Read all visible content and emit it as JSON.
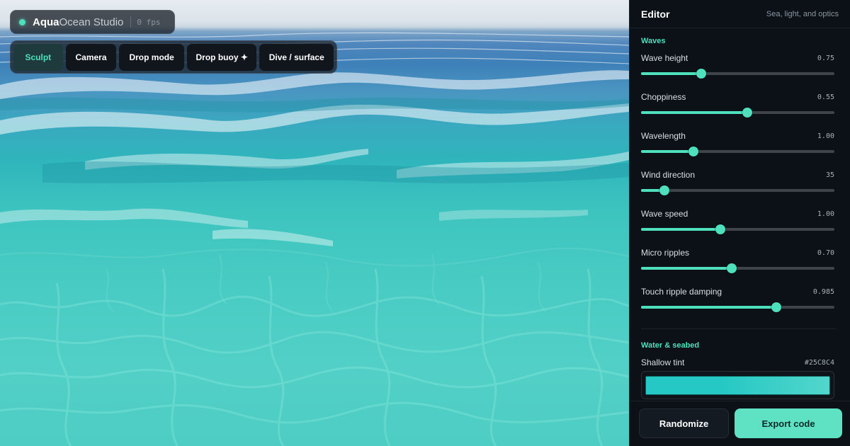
{
  "header": {
    "brand_strong": "Aqua",
    "brand_rest": "Ocean Studio",
    "fps": "0 fps"
  },
  "toolbar": {
    "items": [
      {
        "label": "Sculpt",
        "active": true
      },
      {
        "label": "Camera",
        "active": false
      },
      {
        "label": "Drop mode",
        "active": false
      },
      {
        "label": "Drop buoy ✦",
        "active": false
      },
      {
        "label": "Dive / surface",
        "active": false
      }
    ]
  },
  "editor": {
    "title": "Editor",
    "subtitle": "Sea, light, and optics",
    "waves": {
      "title": "Waves",
      "controls": [
        {
          "label": "Wave height",
          "value": "0.75",
          "fraction": 0.31
        },
        {
          "label": "Choppiness",
          "value": "0.55",
          "fraction": 0.55
        },
        {
          "label": "Wavelength",
          "value": "1.00",
          "fraction": 0.27
        },
        {
          "label": "Wind direction",
          "value": "35",
          "fraction": 0.12
        },
        {
          "label": "Wave speed",
          "value": "1.00",
          "fraction": 0.41
        },
        {
          "label": "Micro ripples",
          "value": "0.70",
          "fraction": 0.47
        },
        {
          "label": "Touch ripple damping",
          "value": "0.985",
          "fraction": 0.7
        }
      ]
    },
    "water": {
      "title": "Water & seabed",
      "shallow_tint_label": "Shallow tint",
      "shallow_tint_value": "#25C8C4"
    },
    "footer": {
      "randomize_label": "Randomize",
      "export_label": "Export code"
    }
  },
  "colors": {
    "accent": "#4EE0BD",
    "panel_bg": "#0C1117",
    "shallow_tint": "#25C8C4"
  }
}
